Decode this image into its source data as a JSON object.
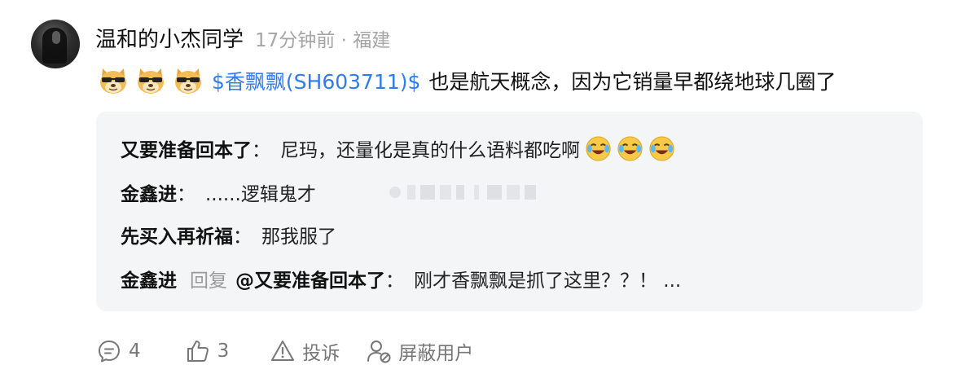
{
  "post": {
    "username": "温和的小杰同学",
    "meta": "17分钟前 · 福建",
    "emojis": [
      "doge",
      "doge",
      "doge"
    ],
    "stock_link": "$香飘飘(SH603711)$",
    "text": "也是航天概念，因为它销量早都绕地球几圈了"
  },
  "replies": [
    {
      "author": "又要准备回本了",
      "colon": "：",
      "text": "尼玛，还量化是真的什么语料都吃啊",
      "emojis": [
        "laugh-cry",
        "laugh-cry",
        "laugh-cry"
      ]
    },
    {
      "author": "金鑫进",
      "colon": "：",
      "text": "......逻辑鬼才"
    },
    {
      "author": "先买入再祈福",
      "colon": "：",
      "text": "那我服了"
    },
    {
      "author": "金鑫进",
      "reply_word": "回复",
      "target": "@又要准备回本了",
      "colon": "：",
      "text": "刚才香飘飘是抓了这里？？！ ..."
    }
  ],
  "actions": {
    "comments": "4",
    "likes": "3",
    "report": "投诉",
    "block": "屏蔽用户"
  },
  "colors": {
    "link": "#2f7cf0",
    "meta": "#a5a5a5",
    "reply_bg": "#f4f5f7"
  }
}
